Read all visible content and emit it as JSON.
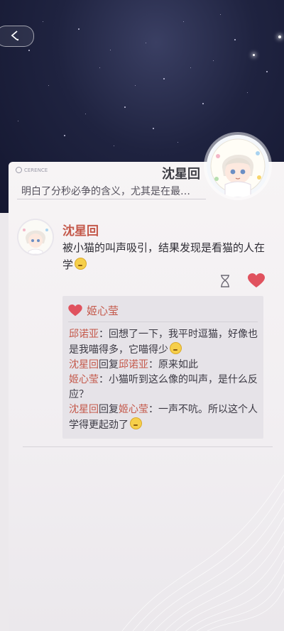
{
  "header": {
    "logo_text": "CERENCE",
    "name": "沈星回",
    "subtitle": "明白了分秒必争的含义，尤其是在最…"
  },
  "post": {
    "author": "沈星回",
    "text": "被小猫的叫声吸引，结果发现是看猫的人在学"
  },
  "comments": {
    "likers": "姬心莹",
    "items": [
      {
        "name": "邱诺亚",
        "reply_to": "",
        "text": "回想了一下，我平时逗猫，好像也是我喵得多，它喵得少"
      },
      {
        "name": "沈星回",
        "reply_word": "回复",
        "reply_to": "邱诺亚",
        "text": "原来如此"
      },
      {
        "name": "姬心莹",
        "reply_to": "",
        "text": "小猫听到这么像的叫声，是什么反应？"
      },
      {
        "name": "沈星回",
        "reply_word": "回复",
        "reply_to": "姬心莹",
        "text": "一声不吭。所以这个人学得更起劲了"
      }
    ]
  },
  "colors": {
    "accent": "#c4584a",
    "sky": "#1f2340",
    "card": "#f3f0f3"
  },
  "icons": [
    "back-arrow-icon",
    "hourglass-icon",
    "heart-icon",
    "emoji-icon"
  ]
}
